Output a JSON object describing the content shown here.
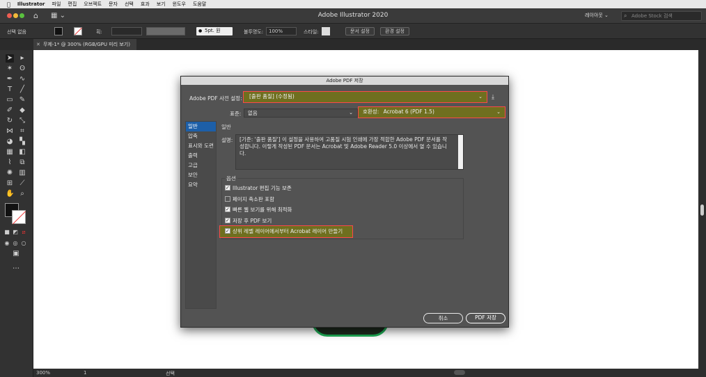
{
  "menubar": {
    "apple_icon": "",
    "app_name": "Illustrator",
    "items": [
      "파일",
      "편집",
      "오브젝트",
      "문자",
      "선택",
      "효과",
      "보기",
      "윈도우",
      "도움말"
    ]
  },
  "titlebar": {
    "title": "Adobe Illustrator 2020",
    "workspace": "레이아웃",
    "stock_search_placeholder": "Adobe Stock 검색"
  },
  "controlbar": {
    "selection_label": "선택 없음",
    "stroke_label": "획:",
    "brush_label": "5pt. 원",
    "opacity_label": "불투명도:",
    "opacity_value": "100%",
    "style_label": "스타일:",
    "doc_setup": "문서 설정",
    "preferences": "환경 설정"
  },
  "document_tab": {
    "label": "무제-1* @ 300% (RGB/GPU 미리 보기)"
  },
  "statusbar": {
    "zoom": "300%",
    "artboard": "1",
    "mode": "선택"
  },
  "dialog": {
    "title": "Adobe PDF 저장",
    "preset_label": "Adobe PDF 사전 설정:",
    "preset_value": "[출판 품질] (수정됨)",
    "standard_label": "표준:",
    "standard_value": "없음",
    "compat_label": "호환성:",
    "compat_value": "Acrobat 6 (PDF 1.5)",
    "sidebar": [
      "일반",
      "압축",
      "표시와 도련",
      "출력",
      "고급",
      "보안",
      "요약"
    ],
    "section_title": "일반",
    "desc_label": "설명:",
    "description": "[기준: '출판 품질'] 이 설정을 사용하여 고품질 시험 인쇄에 가장 적합한 Adobe PDF 문서를 작성합니다. 이렇게 작성된 PDF 문서는 Acrobat 및 Adobe Reader 5.0 이상에서 열 수 있습니다.",
    "options_title": "옵션",
    "options": [
      {
        "label": "Illustrator 편집 기능 보존",
        "checked": true
      },
      {
        "label": "페이지 축소판 포함",
        "checked": false
      },
      {
        "label": "빠른 웹 보기를 위해 최적화",
        "checked": true
      },
      {
        "label": "저장 후 PDF 보기",
        "checked": true
      },
      {
        "label": "상위 레벨 레이어에서부터 Acrobat 레이어 만들기",
        "checked": true
      }
    ],
    "cancel": "취소",
    "save": "PDF 저장"
  }
}
